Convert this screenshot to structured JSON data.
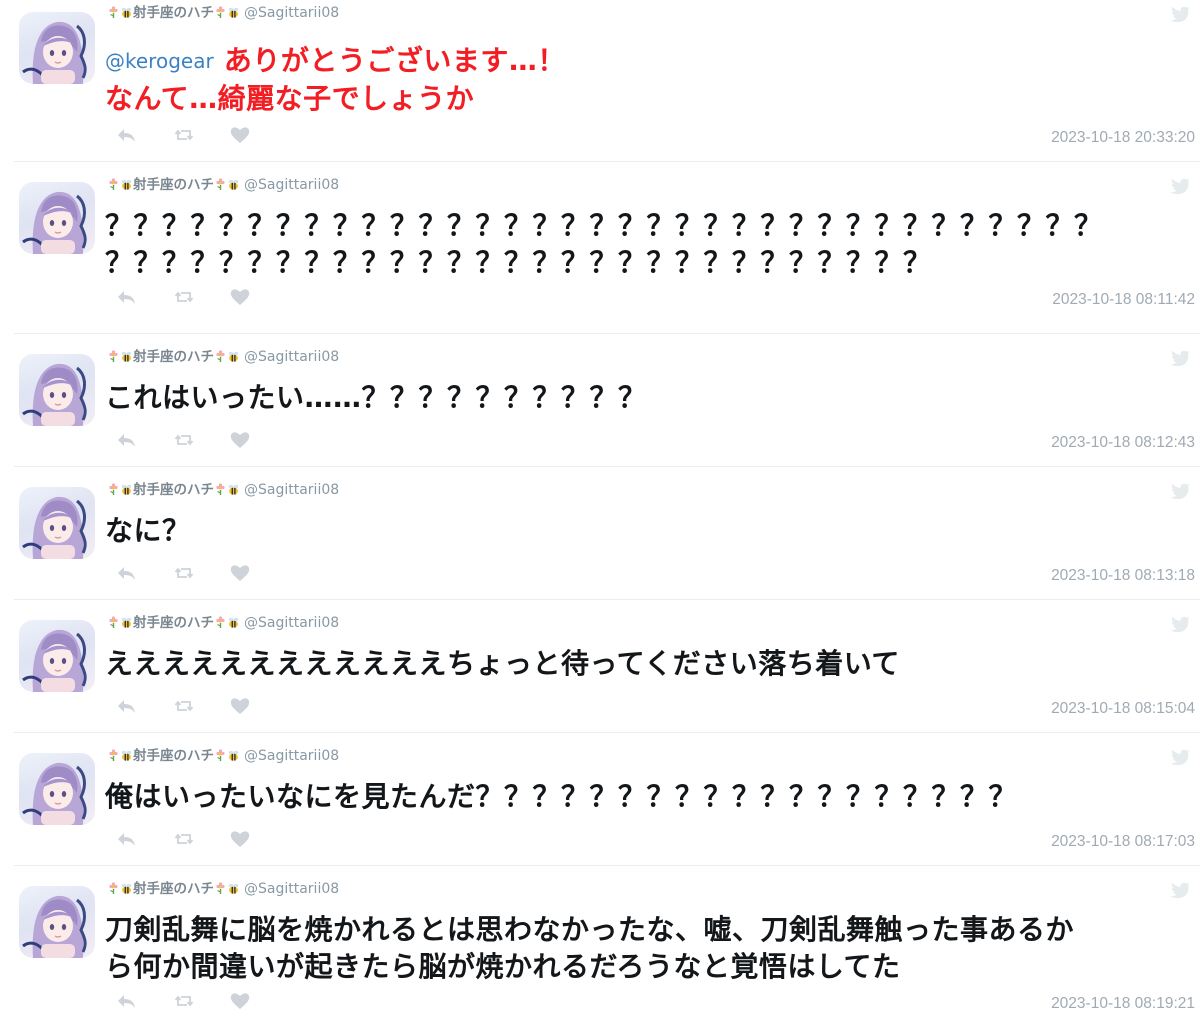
{
  "author": {
    "display_name": "射手座のハチ",
    "handle": "@Sagittarii08"
  },
  "colors": {
    "text": "#14171a",
    "accent_red": "#f21e23",
    "mention_blue": "#3b82c4",
    "muted": "#a0aab3"
  },
  "tweets": [
    {
      "mention": "@kerogear",
      "lines": [
        "ありがとうございます…！",
        "なんて…綺麗な子でしょうか"
      ],
      "timestamp": "2023-10-18 20:33:20",
      "style": "red"
    },
    {
      "lines": [
        "？？？？？？？？？？？？？？？？？？？？？？？？？？？？？？？？？？？",
        "？？？？？？？？？？？？？？？？？？？？？？？？？？？？？"
      ],
      "timestamp": "2023-10-18 08:11:42"
    },
    {
      "lines": [
        "これはいったい……？？？？？？？？？？"
      ],
      "timestamp": "2023-10-18 08:12:43"
    },
    {
      "lines": [
        "なに？"
      ],
      "timestamp": "2023-10-18 08:13:18"
    },
    {
      "lines": [
        "ええええええええええええちょっと待ってください落ち着いて"
      ],
      "timestamp": "2023-10-18 08:15:04"
    },
    {
      "lines": [
        "俺はいったいなにを見たんだ？？？？？？？？？？？？？？？？？？？"
      ],
      "timestamp": "2023-10-18 08:17:03"
    },
    {
      "lines": [
        "刀剣乱舞に脳を焼かれるとは思わなかったな、嘘、刀剣乱舞触った事あるか",
        "ら何か間違いが起きたら脳が焼かれるだろうなと覚悟はしてた"
      ],
      "timestamp": "2023-10-18 08:19:21"
    }
  ],
  "icons": {
    "reply": "reply-icon",
    "retweet": "retweet-icon",
    "like": "heart-icon",
    "source": "twitter-bird-icon"
  }
}
